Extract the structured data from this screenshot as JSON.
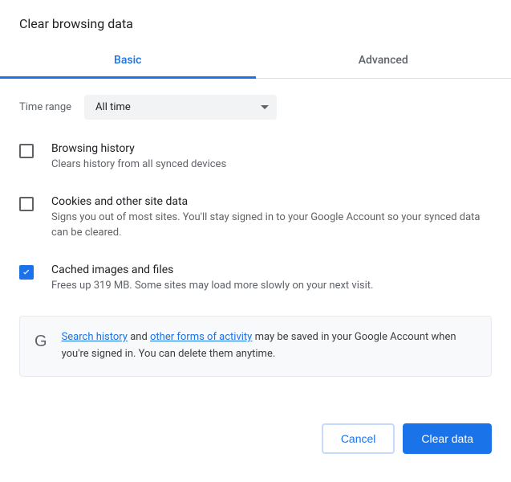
{
  "dialog": {
    "title": "Clear browsing data"
  },
  "tabs": {
    "basic": "Basic",
    "advanced": "Advanced"
  },
  "timeRange": {
    "label": "Time range",
    "value": "All time"
  },
  "options": {
    "browsingHistory": {
      "title": "Browsing history",
      "desc": "Clears history from all synced devices",
      "checked": false
    },
    "cookies": {
      "title": "Cookies and other site data",
      "desc": "Signs you out of most sites. You'll stay signed in to your Google Account so your synced data can be cleared.",
      "checked": false
    },
    "cache": {
      "title": "Cached images and files",
      "desc": "Frees up 319 MB. Some sites may load more slowly on your next visit.",
      "checked": true
    }
  },
  "info": {
    "link1": "Search history",
    "text1": " and ",
    "link2": "other forms of activity",
    "text2": " may be saved in your Google Account when you're signed in. You can delete them anytime."
  },
  "actions": {
    "cancel": "Cancel",
    "clear": "Clear data"
  }
}
